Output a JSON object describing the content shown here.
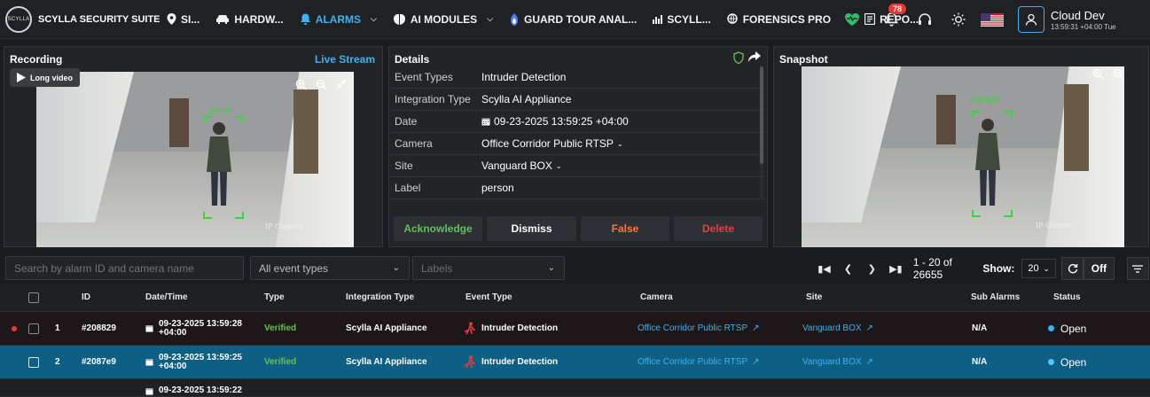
{
  "app": {
    "logo_text": "SCYLLA",
    "title": "SCYLLA SECURITY SUITE"
  },
  "nav": {
    "items": [
      {
        "label": "SI..."
      },
      {
        "label": "HARDW..."
      },
      {
        "label": "ALARMS"
      },
      {
        "label": "AI MODULES"
      },
      {
        "label": "GUARD TOUR ANAL..."
      },
      {
        "label": "SCYLL..."
      },
      {
        "label": "FORENSICS PRO"
      },
      {
        "label": "REPO..."
      }
    ],
    "notifications_count": "78"
  },
  "user": {
    "name": "Cloud Dev",
    "time": "13:59:31 +04:00 Tue"
  },
  "recording": {
    "title": "Recording",
    "live_link": "Live Stream",
    "long_video": "Long video",
    "overlay_label": "person",
    "camera_tag": "IP Camera"
  },
  "details": {
    "title": "Details",
    "rows": [
      {
        "key": "Event Types",
        "value": "Intruder Detection"
      },
      {
        "key": "Integration Type",
        "value": "Scylla AI Appliance"
      },
      {
        "key": "Date",
        "value": "09-23-2025 13:59:25 +04:00"
      },
      {
        "key": "Camera",
        "value": "Office Corridor Public RTSP"
      },
      {
        "key": "Site",
        "value": "Vanguard BOX"
      },
      {
        "key": "Label",
        "value": "person"
      }
    ],
    "actions": {
      "acknowledge": "Acknowledge",
      "dismiss": "Dismiss",
      "false": "False",
      "delete": "Delete"
    }
  },
  "snapshot": {
    "title": "Snapshot",
    "overlay_label": "person",
    "camera_tag": "IP Camera"
  },
  "filters": {
    "search_placeholder": "Search by alarm ID and camera name",
    "event_types": "All event types",
    "labels": "Labels"
  },
  "pager": {
    "info": "1 - 20 of 26655",
    "show_label": "Show:",
    "show_value": "20",
    "off_label": "Off"
  },
  "table": {
    "headers": {
      "id": "ID",
      "datetime": "Date/Time",
      "type": "Type",
      "integration": "Integration Type",
      "event": "Event Type",
      "camera": "Camera",
      "site": "Site",
      "sub_alarms": "Sub Alarms",
      "status": "Status"
    },
    "rows": [
      {
        "num": "1",
        "id": "#208829",
        "date": "09-23-2025 13:59:28",
        "tz": "+04:00",
        "type": "Verified",
        "integration": "Scylla AI Appliance",
        "event": "Intruder Detection",
        "camera": "Office Corridor Public RTSP",
        "site": "Vanguard BOX",
        "sub_alarms": "N/A",
        "status": "Open"
      },
      {
        "num": "2",
        "id": "#2087e9",
        "date": "09-23-2025 13:59:25",
        "tz": "+04:00",
        "type": "Verified",
        "integration": "Scylla AI Appliance",
        "event": "Intruder Detection",
        "camera": "Office Corridor Public RTSP",
        "site": "Vanguard BOX",
        "sub_alarms": "N/A",
        "status": "Open"
      },
      {
        "date": "09-23-2025 13:59:22"
      }
    ]
  },
  "colors": {
    "accent": "#3bb3f2",
    "verified": "#66c24f",
    "false": "#f07b3c",
    "delete": "#e0443c",
    "acknowledge": "#5fbf5f",
    "selected_row": "#0e5f84"
  }
}
